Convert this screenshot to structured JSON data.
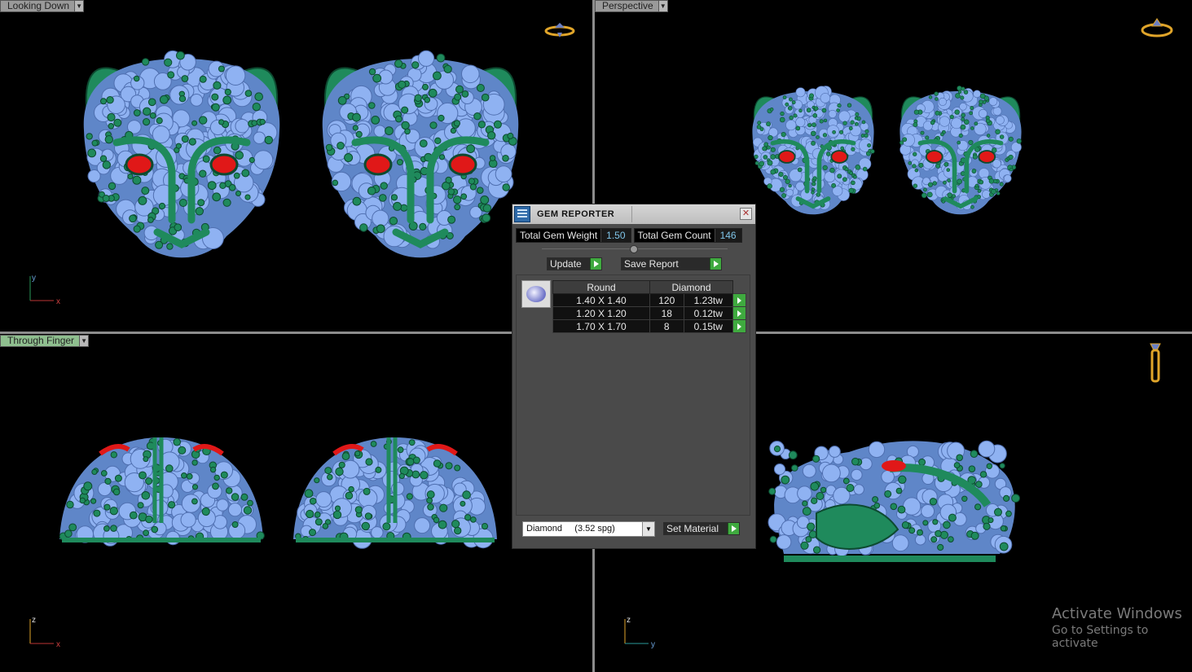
{
  "viewports": {
    "top_left": {
      "label": "Looking Down",
      "axis": [
        "y",
        "x"
      ]
    },
    "top_right": {
      "label": "Perspective"
    },
    "bottom_left": {
      "label": "Through Finger",
      "axis": [
        "z",
        "x"
      ]
    },
    "bottom_right": {
      "axis": [
        "z",
        "y"
      ]
    }
  },
  "gem_reporter": {
    "title": "GEM REPORTER",
    "close_glyph": "✕",
    "total_weight_label": "Total Gem Weight",
    "total_weight_value": "1.50",
    "total_count_label": "Total Gem Count",
    "total_count_value": "146",
    "update_label": "Update",
    "save_report_label": "Save Report",
    "table": {
      "headers": [
        "Round",
        "Diamond"
      ],
      "rows": [
        {
          "size": "1.40 X 1.40",
          "count": "120",
          "weight": "1.23tw"
        },
        {
          "size": "1.20 X 1.20",
          "count": "18",
          "weight": "0.12tw"
        },
        {
          "size": "1.70 X 1.70",
          "count": "8",
          "weight": "0.15tw"
        }
      ]
    },
    "material_select": "Diamond     (3.52 spg)",
    "set_material_label": "Set Material"
  },
  "colors": {
    "metal": "#1f8a5c",
    "gem": "#8fb2f2",
    "eye": "#e01818",
    "background": "#000000"
  },
  "watermark": {
    "line1": "Activate Windows",
    "line2": "Go to Settings to activate"
  }
}
